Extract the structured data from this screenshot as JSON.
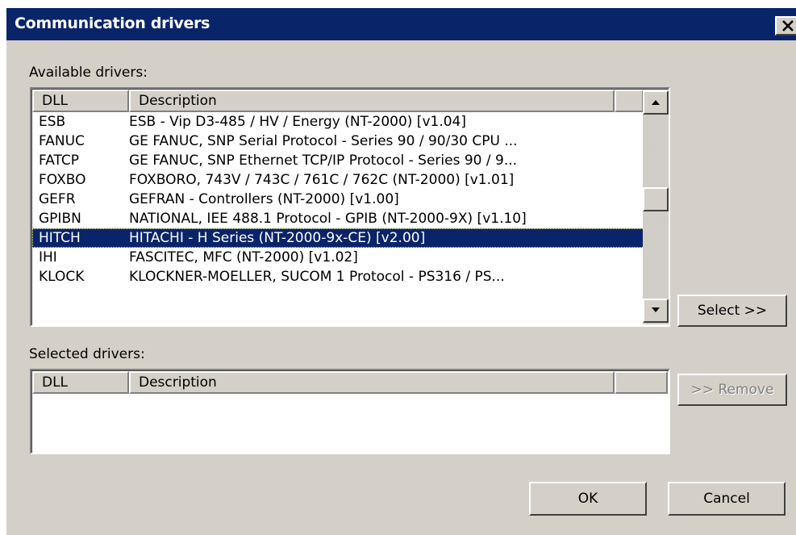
{
  "window": {
    "title": "Communication drivers",
    "close_glyph": "✕"
  },
  "available": {
    "label": "Available drivers:",
    "columns": {
      "dll": "DLL",
      "description": "Description"
    },
    "rows": [
      {
        "dll": "ESB",
        "description": "ESB - Vip D3-485 / HV / Energy (NT-2000) [v1.04]"
      },
      {
        "dll": "FANUC",
        "description": "GE FANUC, SNP Serial Protocol - Series 90 / 90/30 CPU ..."
      },
      {
        "dll": "FATCP",
        "description": "GE FANUC, SNP Ethernet TCP/IP Protocol - Series 90 / 9..."
      },
      {
        "dll": "FOXBO",
        "description": "FOXBORO, 743V / 743C / 761C / 762C (NT-2000) [v1.01]"
      },
      {
        "dll": "GEFR",
        "description": "GEFRAN - Controllers (NT-2000) [v1.00]"
      },
      {
        "dll": "GPIBN",
        "description": "NATIONAL, IEE 488.1 Protocol - GPIB (NT-2000-9X) [v1.10]"
      },
      {
        "dll": "HITCH",
        "description": "HITACHI - H Series (NT-2000-9x-CE) [v2.00]"
      },
      {
        "dll": "IHI",
        "description": "FASCITEC, MFC (NT-2000) [v1.02]"
      },
      {
        "dll": "KLOCK",
        "description": "KLOCKNER-MOELLER, SUCOM 1 Protocol - PS316 / PS..."
      }
    ],
    "selected_index": 6
  },
  "selected": {
    "label": "Selected drivers:",
    "columns": {
      "dll": "DLL",
      "description": "Description"
    },
    "rows": []
  },
  "buttons": {
    "select": "Select >>",
    "remove": ">> Remove",
    "ok": "OK",
    "cancel": "Cancel"
  },
  "colors": {
    "titlebar": "#0a246a",
    "selection": "#0a246a",
    "face": "#d4d0c8"
  }
}
